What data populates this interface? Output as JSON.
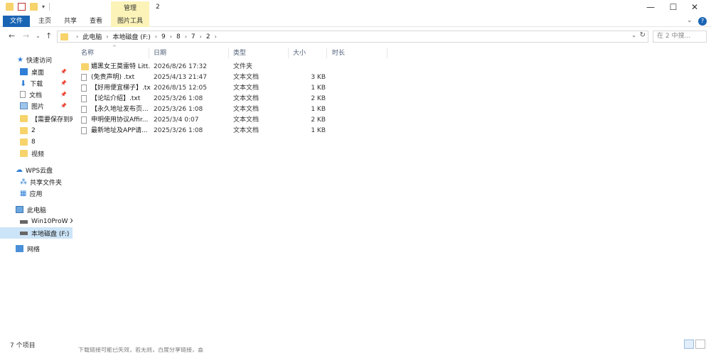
{
  "title_bar": {
    "tool_tab": "管理",
    "window_title": "2",
    "minimize": "—",
    "maximize": "☐",
    "close": "✕"
  },
  "ribbon": {
    "tabs": [
      "文件",
      "主页",
      "共享",
      "查看",
      "图片工具"
    ],
    "help": "?"
  },
  "address": {
    "crumbs": [
      "此电脑",
      "本地磁盘 (F:)",
      "9",
      "8",
      "7",
      "2"
    ],
    "search_placeholder": "在 2 中搜..."
  },
  "sidebar": {
    "items": [
      {
        "label": "快速访问",
        "icon": "star-icon"
      },
      {
        "label": "桌面",
        "icon": "desktop-icon",
        "pinned": true
      },
      {
        "label": "下载",
        "icon": "download-icon",
        "pinned": true
      },
      {
        "label": "文档",
        "icon": "document-icon",
        "pinned": true
      },
      {
        "label": "图片",
        "icon": "picture-icon",
        "pinned": true
      },
      {
        "label": "【需要保存到网",
        "icon": "folder-icon"
      },
      {
        "label": "2",
        "icon": "folder-icon"
      },
      {
        "label": "8",
        "icon": "folder-icon"
      },
      {
        "label": "视频",
        "icon": "folder-icon"
      },
      {
        "label": "WPS云盘",
        "icon": "cloud-icon"
      },
      {
        "label": "共享文件夹",
        "icon": "share-icon"
      },
      {
        "label": "应用",
        "icon": "apps-icon"
      },
      {
        "label": "此电脑",
        "icon": "computer-icon"
      },
      {
        "label": "Win10ProW X",
        "icon": "drive-icon"
      },
      {
        "label": "本地磁盘 (F:)",
        "icon": "drive-icon",
        "selected": true
      },
      {
        "label": "网络",
        "icon": "network-icon"
      }
    ]
  },
  "columns": [
    "名称",
    "日期",
    "类型",
    "大小",
    "时长"
  ],
  "files": [
    {
      "name": "媚黑女王莫雷特 Litt...",
      "date": "2026/8/26 17:32",
      "type": "文件夹",
      "size": "",
      "icon": "folder-icon"
    },
    {
      "name": "(免责声明) .txt",
      "date": "2025/4/13 21:47",
      "type": "文本文档",
      "size": "3 KB",
      "icon": "text-file-icon"
    },
    {
      "name": "【好用便宜梯子】.txt",
      "date": "2026/8/15 12:05",
      "type": "文本文档",
      "size": "1 KB",
      "icon": "text-file-icon"
    },
    {
      "name": "【论坛介绍】.txt",
      "date": "2025/3/26 1:08",
      "type": "文本文档",
      "size": "2 KB",
      "icon": "text-file-icon"
    },
    {
      "name": "【永久地址发布页...",
      "date": "2025/3/26 1:08",
      "type": "文本文档",
      "size": "1 KB",
      "icon": "text-file-icon"
    },
    {
      "name": "申明使用协议Affir...",
      "date": "2025/3/4 0:07",
      "type": "文本文档",
      "size": "2 KB",
      "icon": "text-file-icon"
    },
    {
      "name": "最新地址及APP请...",
      "date": "2025/3/26 1:08",
      "type": "文本文档",
      "size": "1 KB",
      "icon": "text-file-icon"
    }
  ],
  "status": {
    "count": "7 个项目",
    "taskbar_peek": "下载链接可能已失效，若无则，百度分享链接，喜"
  }
}
